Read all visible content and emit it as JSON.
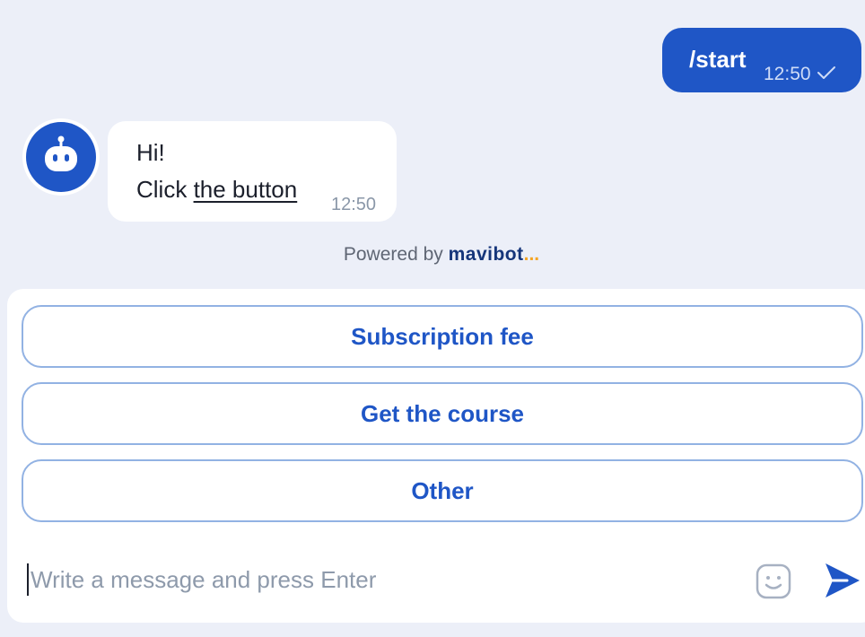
{
  "user_message": {
    "text": "/start",
    "time": "12:50",
    "status_icon": "check-icon"
  },
  "bot_message": {
    "avatar_icon": "robot-icon",
    "line1": "Hi!",
    "line2_prefix": "Click ",
    "link_text": "the button",
    "time": "12:50"
  },
  "powered_by": {
    "label": "Powered by",
    "brand": "mavibot",
    "brand_dots": "..."
  },
  "quick_replies": [
    {
      "label": "Subscription fee"
    },
    {
      "label": "Get the course"
    },
    {
      "label": "Other"
    }
  ],
  "composer": {
    "placeholder": "Write a message and press Enter",
    "emoji_icon": "smiley-icon",
    "send_icon": "send-icon"
  },
  "colors": {
    "accent": "#1f56c6",
    "background": "#eceff8",
    "button_border": "#92b2e3",
    "brand_dots": "#f5a524"
  }
}
